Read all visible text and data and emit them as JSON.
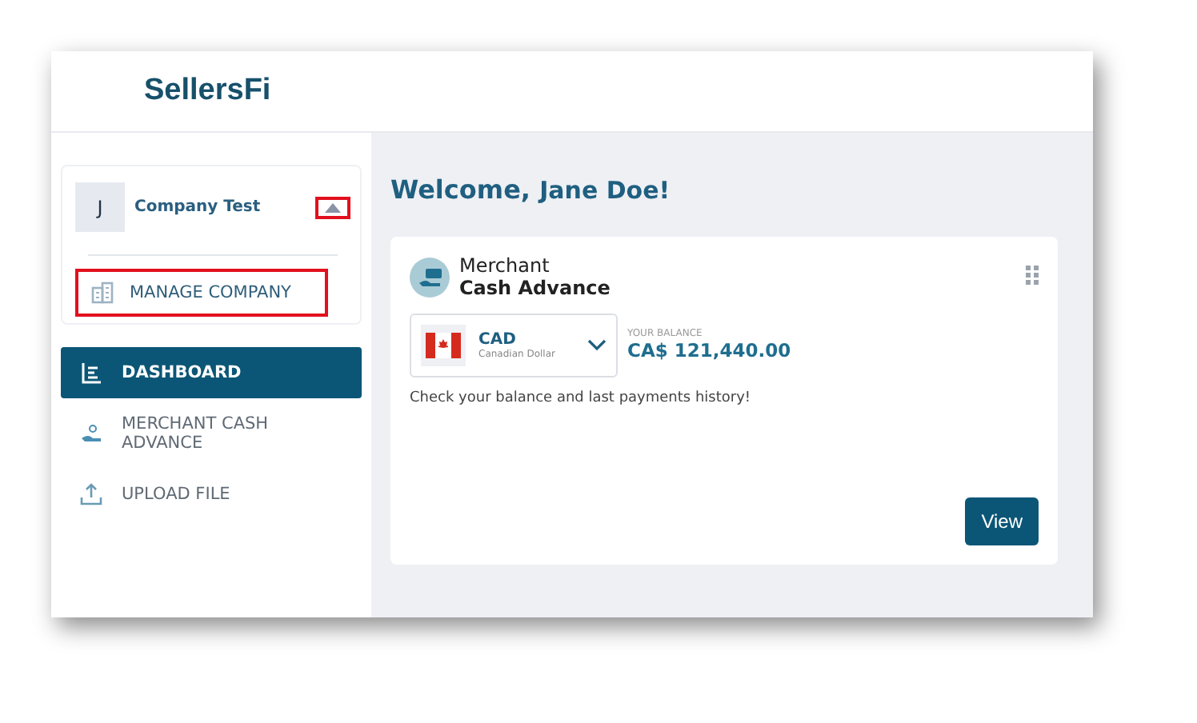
{
  "logo": "SellersFi",
  "company": {
    "initial": "J",
    "name": "Company Test",
    "expanded": true,
    "toggle_highlighted": true
  },
  "company_menu": [
    {
      "label": "MANAGE COMPANY",
      "kind": "building",
      "highlighted": true
    }
  ],
  "nav": [
    {
      "label": "DASHBOARD",
      "kind": "chart",
      "selected": true
    },
    {
      "label": "MERCHANT CASH ADVANCE",
      "kind": "hand",
      "selected": false
    },
    {
      "label": "UPLOAD FILE",
      "kind": "upload",
      "selected": false
    }
  ],
  "greeting": {
    "prefix": "Welcome,",
    "name": "Jane Doe!"
  },
  "card": {
    "title_line1": "Merchant",
    "title_line2": "Cash Advance",
    "currency": {
      "code": "CAD",
      "name": "Canadian Dollar"
    },
    "balance_label": "YOUR BALANCE",
    "balance": "CA$ 121,440.00",
    "description": "Check your balance and last payments history!",
    "button": "View"
  }
}
